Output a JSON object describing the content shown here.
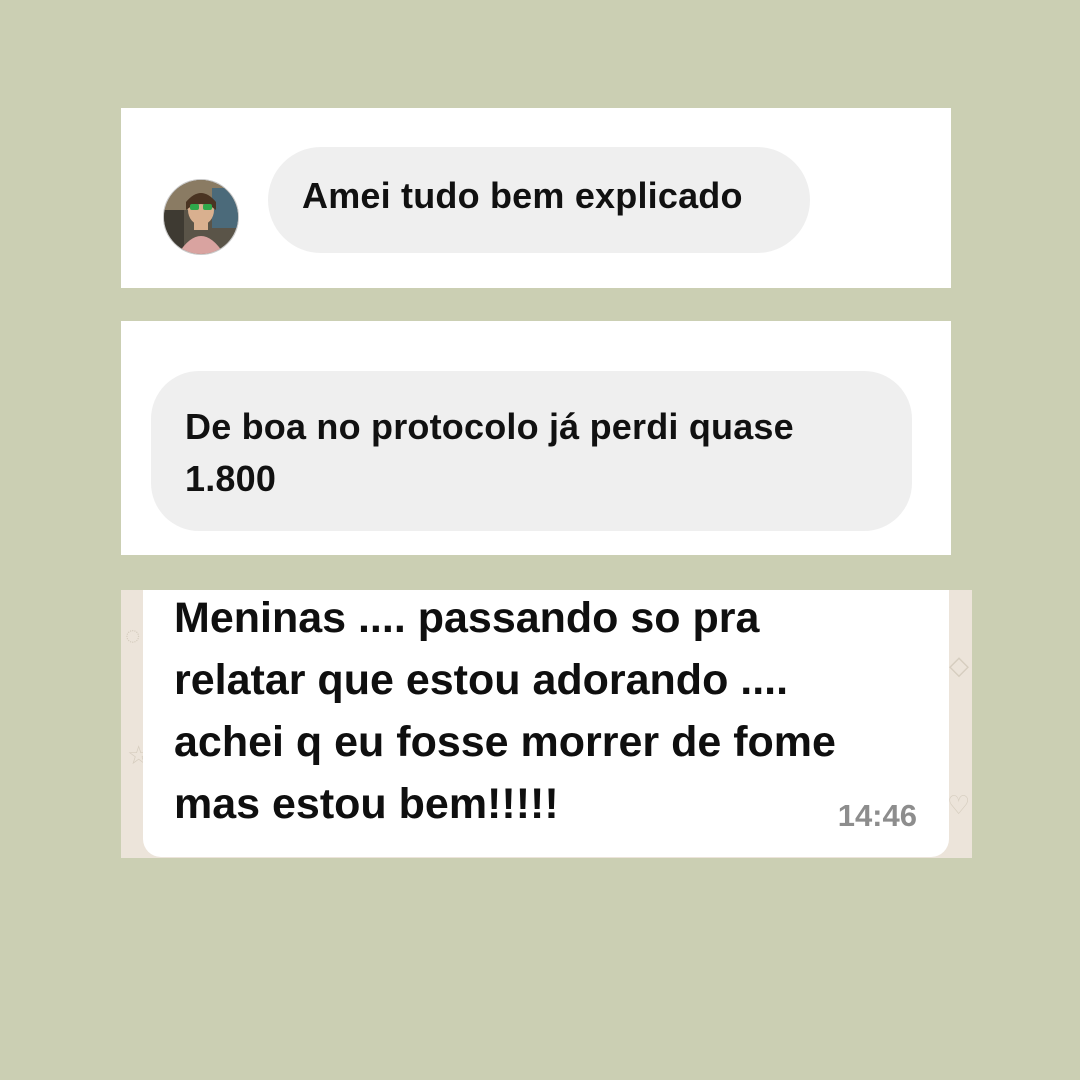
{
  "messages": [
    {
      "text": "Amei tudo bem explicado"
    },
    {
      "text": "De boa no protocolo já perdi quase 1.800"
    },
    {
      "text": "Meninas .... passando so pra\nrelatar que estou adorando ....\nachei q eu fosse morrer de fome\nmas estou bem!!!!!",
      "time": "14:46"
    }
  ],
  "colors": {
    "page_background": "#cbcfb3",
    "card_background": "#ffffff",
    "instagram_bubble": "#efefef",
    "whatsapp_wallpaper": "#ece4da",
    "timestamp": "#8d8d8d"
  },
  "icons": {
    "avatar": "user-avatar-photo"
  }
}
